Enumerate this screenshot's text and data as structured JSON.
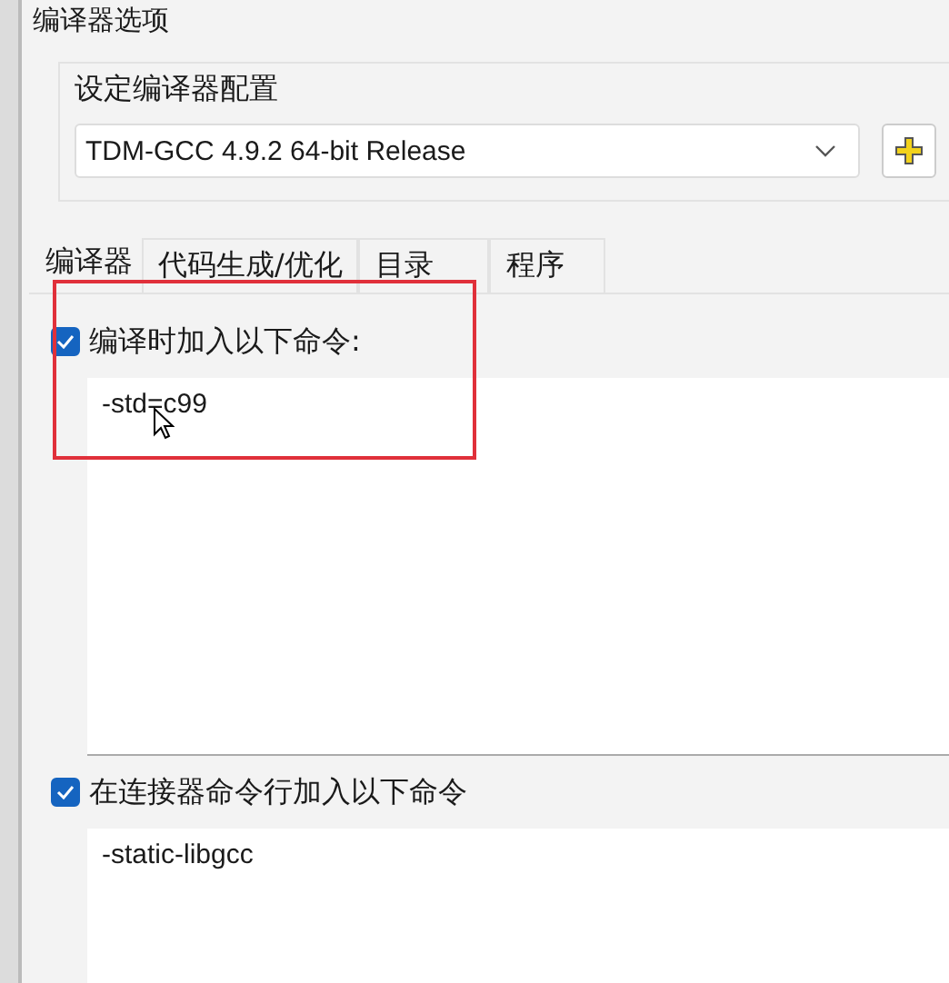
{
  "window": {
    "title": "编译器选项"
  },
  "compiler_config": {
    "label": "设定编译器配置",
    "value": "TDM-GCC 4.9.2 64-bit Release"
  },
  "tabs": [
    {
      "label": "编译器",
      "selected": true
    },
    {
      "label": "代码生成/优化",
      "selected": false
    },
    {
      "label": "目录",
      "selected": false
    },
    {
      "label": "程序",
      "selected": false
    }
  ],
  "compile_commands": {
    "label": "编译时加入以下命令:",
    "checked": true,
    "value": "-std=c99",
    "highlighted": true
  },
  "linker_commands": {
    "label": "在连接器命令行加入以下命令",
    "checked": true,
    "value": "-static-libgcc"
  }
}
